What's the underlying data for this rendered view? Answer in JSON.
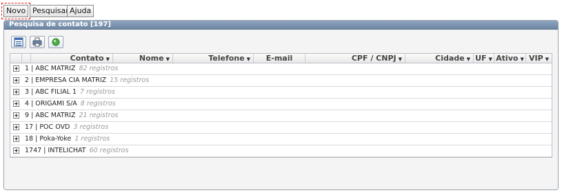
{
  "toolbar": {
    "new_label": "Novo",
    "search_label": "Pesquisar",
    "help_label": "Ajuda"
  },
  "panel": {
    "title": "Pesquisa de contato [197]"
  },
  "icon_bar": [
    {
      "name": "grid-view-icon"
    },
    {
      "name": "print-icon"
    },
    {
      "name": "refresh-icon"
    }
  ],
  "table": {
    "columns": [
      "Contato",
      "Nome",
      "Telefone",
      "E-mail",
      "CPF / CNPJ",
      "Cidade",
      "UF",
      "Ativo",
      "VIP"
    ],
    "groups": [
      {
        "label": "1 | ABC MATRIZ",
        "count": "82 registros"
      },
      {
        "label": "2 | EMPRESA CIA MATRIZ",
        "count": "15 registros"
      },
      {
        "label": "3 | ABC FILIAL 1",
        "count": "7 registros"
      },
      {
        "label": "4 | ORIGAMI S/A",
        "count": "8 registros"
      },
      {
        "label": "9 | ABC MATRIZ",
        "count": "21 registros"
      },
      {
        "label": "17 | POC OVD",
        "count": "3 registros"
      },
      {
        "label": "18 | Poka-Yoke",
        "count": "1 registros"
      },
      {
        "label": "1747 | INTELICHAT",
        "count": "60 registros"
      }
    ]
  },
  "colors": {
    "header_bar": "#7b91ad",
    "focus_outline": "#d81b1b"
  }
}
